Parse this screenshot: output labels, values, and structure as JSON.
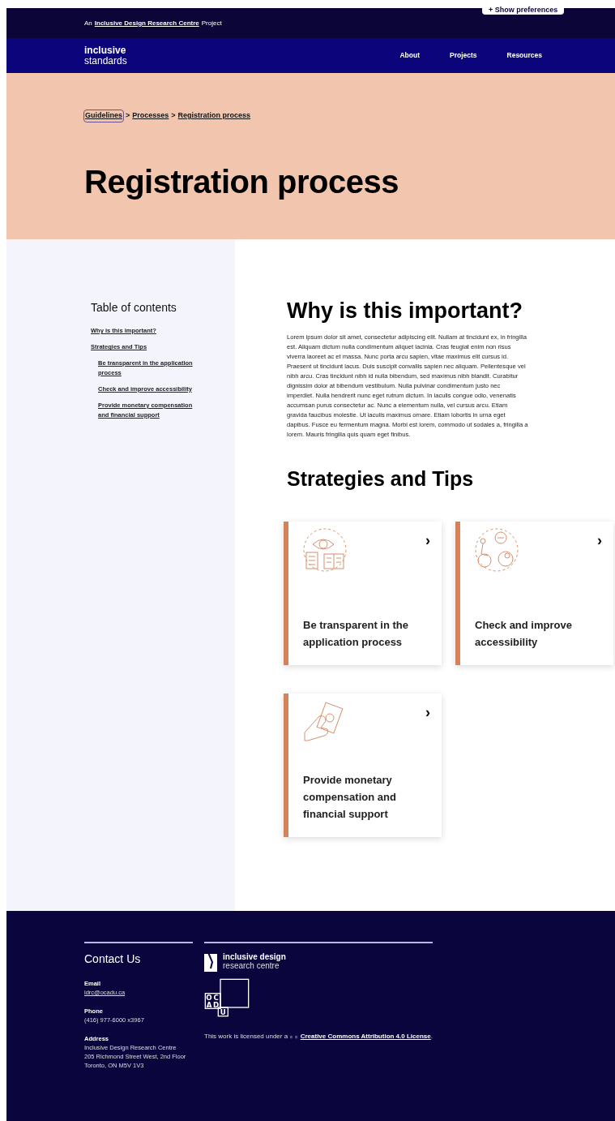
{
  "preferences_button": "+ Show preferences",
  "top_bar": {
    "prefix": "An",
    "link": "Inclusive Design Research Centre",
    "suffix": "Project"
  },
  "logo": {
    "line_1": "inclusive",
    "line_2": "standards"
  },
  "nav": [
    "About",
    "Projects",
    "Resources"
  ],
  "breadcrumb": [
    {
      "label": "Guidelines",
      "focused": true
    },
    {
      "label": "Processes",
      "focused": false
    },
    {
      "label": "Registration process",
      "focused": false
    }
  ],
  "breadcrumb_separator": ">",
  "page_title": "Registration process",
  "toc": {
    "title": "Table of contents",
    "items": [
      {
        "label": "Why is this important?"
      },
      {
        "label": "Strategies and Tips",
        "children": [
          {
            "label": "Be transparent in the application process"
          },
          {
            "label": "Check and improve accessibility"
          },
          {
            "label": "Provide monetary compensation and financial support"
          }
        ]
      }
    ]
  },
  "section_1": {
    "heading": "Why is this important?",
    "body": "Lorem ipsum dolor sit amet, consectetur adipiscing elit. Nullam at tincidunt ex, in fringilla est. Aliquam dictum nulla condimentum aliquet lacinia. Cras feugiat enim non risus viverra laoreet ac et massa. Nunc porta arcu sapien, vitae maximus elit cursus id. Praesent ut tincidunt lacus. Duis suscipit convallis sapien nec aliquam. Pellentesque vel nibh arcu. Cras tincidunt nibh id nulla bibendum, sed maximus nibh blandit. Curabitur dignissim dolor at bibendum vestibulum. Nulla pulvinar condimentum justo nec imperdiet. Nulla hendrerit nunc eget rutrum dictum. In iaculis congue odio, venenatis accumsan purus consectetur ac. Nunc a elementum nulla, vel cursus arcu. Etiam gravida faucibus molestie. Ut iaculis maximus ornare. Etiam lobortis in urna eget dapibus. Fusce eu fermentum magna. Morbi est lorem, commodo ut sodales a, fringilla a lorem. Mauris fringilla quis quam eget finibus."
  },
  "section_2": {
    "heading": "Strategies and Tips",
    "cards": [
      {
        "kind": "transparency",
        "title": "Be transparent in the application process",
        "chevron": "›"
      },
      {
        "kind": "accessibility",
        "title": "Check and improve accessibility",
        "chevron": "›"
      },
      {
        "kind": "money",
        "title": "Provide monetary compensation and financial support",
        "chevron": "›"
      }
    ]
  },
  "footer": {
    "contact_title": "Contact Us",
    "contacts": [
      {
        "label": "Email",
        "lines": [
          "idrc@ocadu.ca"
        ],
        "link": true
      },
      {
        "label": "Phone",
        "lines": [
          "(416) 977-6000 x3967"
        ],
        "link": false
      },
      {
        "label": "Address",
        "lines": [
          "Inclusive Design Research Centre",
          "205 Richmond Street West, 2nd Floor",
          "Toronto, ON M5V 1V3"
        ],
        "link": false
      }
    ],
    "idrc_logo": {
      "line_1": "inclusive design",
      "line_2": "research centre"
    },
    "ocad_letters": [
      "O",
      "C",
      "A",
      "D",
      "U"
    ],
    "license_prefix": "This work is licensed under a",
    "license_link": "Creative Commons Attribution 4.0 License",
    "license_suffix": "."
  }
}
